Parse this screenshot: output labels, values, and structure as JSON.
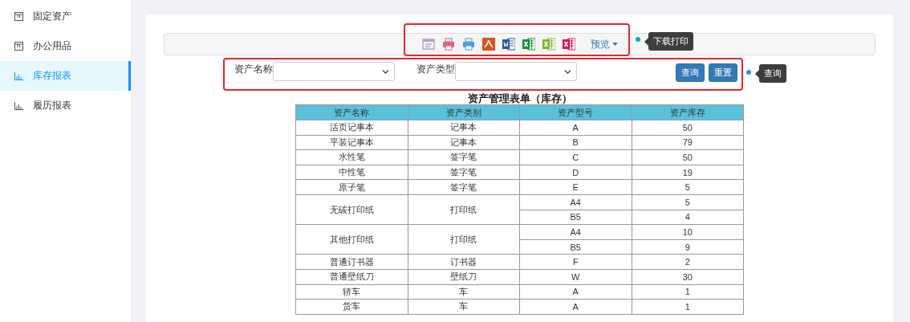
{
  "sidebar": {
    "items": [
      {
        "label": "固定资产",
        "kind": "table",
        "selected": false
      },
      {
        "label": "办公用品",
        "kind": "table",
        "selected": false
      },
      {
        "label": "库存报表",
        "kind": "chart",
        "selected": true
      },
      {
        "label": "履历报表",
        "kind": "chart",
        "selected": false
      }
    ]
  },
  "toolbar": {
    "icons": [
      {
        "kind": "preview",
        "color": "#b9a4cc"
      },
      {
        "kind": "printer",
        "color": "#e0608a"
      },
      {
        "kind": "printer",
        "color": "#4a9ee0"
      },
      {
        "kind": "pdf",
        "color": "#d9541e"
      },
      {
        "kind": "doc",
        "color": "#2b5797"
      },
      {
        "kind": "sheet",
        "color": "#1e8a3a"
      },
      {
        "kind": "sheet",
        "color": "#7cb82f"
      },
      {
        "kind": "sheet",
        "color": "#d4145a"
      }
    ],
    "preview_menu": {
      "label": "预览"
    }
  },
  "filters": {
    "fields": [
      {
        "label": "资产名称"
      },
      {
        "label": "资产类型"
      }
    ],
    "buttons": [
      {
        "label": "查询"
      },
      {
        "label": "重置"
      }
    ]
  },
  "annotations": [
    {
      "label": "下载打印"
    },
    {
      "label": "查询"
    }
  ],
  "table": {
    "title": "资产管理表单（库存）",
    "columns": [
      "资产名称",
      "资产类别",
      "资产型号",
      "资产库存"
    ],
    "rows": [
      {
        "name": "活页记事本",
        "category": "记事本",
        "variants": [
          {
            "model": "A",
            "stock": "50"
          }
        ]
      },
      {
        "name": "平装记事本",
        "category": "记事本",
        "variants": [
          {
            "model": "B",
            "stock": "79"
          }
        ]
      },
      {
        "name": "水性笔",
        "category": "签字笔",
        "variants": [
          {
            "model": "C",
            "stock": "50"
          }
        ]
      },
      {
        "name": "中性笔",
        "category": "签字笔",
        "variants": [
          {
            "model": "D",
            "stock": "19"
          }
        ]
      },
      {
        "name": "原子笔",
        "category": "签字笔",
        "variants": [
          {
            "model": "E",
            "stock": "5"
          }
        ]
      },
      {
        "name": "无碳打印纸",
        "category": "打印纸",
        "variants": [
          {
            "model": "A4",
            "stock": "5"
          },
          {
            "model": "B5",
            "stock": "4"
          }
        ]
      },
      {
        "name": "其他打印纸",
        "category": "打印纸",
        "variants": [
          {
            "model": "A4",
            "stock": "10"
          },
          {
            "model": "B5",
            "stock": "9"
          }
        ]
      },
      {
        "name": "普通订书器",
        "category": "订书器",
        "variants": [
          {
            "model": "F",
            "stock": "2"
          }
        ]
      },
      {
        "name": "普通壁纸刀",
        "category": "壁纸刀",
        "variants": [
          {
            "model": "W",
            "stock": "30"
          }
        ]
      },
      {
        "name": "轿车",
        "category": "车",
        "variants": [
          {
            "model": "A",
            "stock": "1"
          }
        ]
      },
      {
        "name": "货车",
        "category": "车",
        "variants": [
          {
            "model": "A",
            "stock": "1"
          }
        ]
      }
    ]
  }
}
